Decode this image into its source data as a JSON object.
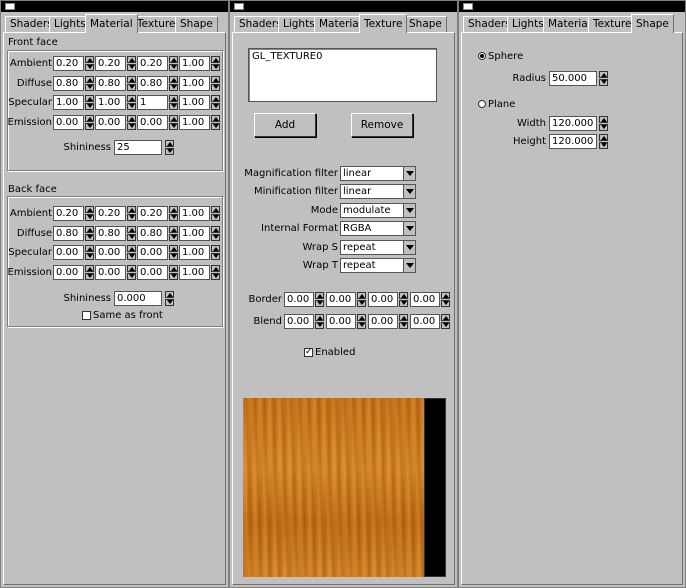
{
  "tabs": [
    "Shaders",
    "Lights",
    "Material",
    "Texture",
    "Shape"
  ],
  "material_window": {
    "active_tab": "Material",
    "front_face": {
      "title": "Front face",
      "rows": [
        {
          "label": "Ambient",
          "values": [
            "0.20",
            "0.20",
            "0.20",
            "1.00"
          ]
        },
        {
          "label": "Diffuse",
          "values": [
            "0.80",
            "0.80",
            "0.80",
            "1.00"
          ]
        },
        {
          "label": "Specular",
          "values": [
            "1.00",
            "1.00",
            "1",
            "1.00"
          ]
        },
        {
          "label": "Emission",
          "values": [
            "0.00",
            "0.00",
            "0.00",
            "1.00"
          ]
        }
      ],
      "shininess_label": "Shininess",
      "shininess_value": "25"
    },
    "back_face": {
      "title": "Back face",
      "rows": [
        {
          "label": "Ambient",
          "values": [
            "0.20",
            "0.20",
            "0.20",
            "1.00"
          ]
        },
        {
          "label": "Diffuse",
          "values": [
            "0.80",
            "0.80",
            "0.80",
            "1.00"
          ]
        },
        {
          "label": "Specular",
          "values": [
            "0.00",
            "0.00",
            "0.00",
            "1.00"
          ]
        },
        {
          "label": "Emission",
          "values": [
            "0.00",
            "0.00",
            "0.00",
            "1.00"
          ]
        }
      ],
      "shininess_label": "Shininess",
      "shininess_value": "0.000",
      "same_as_front_label": "Same as front",
      "same_as_front_checked": false
    }
  },
  "texture_window": {
    "active_tab": "Texture",
    "texture_list": [
      "GL_TEXTURE0"
    ],
    "add_label": "Add",
    "remove_label": "Remove",
    "settings": [
      {
        "label": "Magnification filter",
        "value": "linear"
      },
      {
        "label": "Minification filter",
        "value": "linear"
      },
      {
        "label": "Mode",
        "value": "modulate"
      },
      {
        "label": "Internal Format",
        "value": "RGBA"
      },
      {
        "label": "Wrap S",
        "value": "repeat"
      },
      {
        "label": "Wrap T",
        "value": "repeat"
      }
    ],
    "border": {
      "label": "Border",
      "values": [
        "0.00",
        "0.00",
        "0.00",
        "0.00"
      ]
    },
    "blend": {
      "label": "Blend",
      "values": [
        "0.00",
        "0.00",
        "0.00",
        "0.00"
      ]
    },
    "enabled_label": "Enabled",
    "enabled_checked": true,
    "preview_description": "wood texture preview"
  },
  "shape_window": {
    "active_tab": "Shape",
    "sphere_label": "Sphere",
    "sphere_selected": true,
    "radius_label": "Radius",
    "radius_value": "50.000",
    "plane_label": "Plane",
    "plane_selected": false,
    "width_label": "Width",
    "width_value": "120.000",
    "height_label": "Height",
    "height_value": "120.000"
  }
}
